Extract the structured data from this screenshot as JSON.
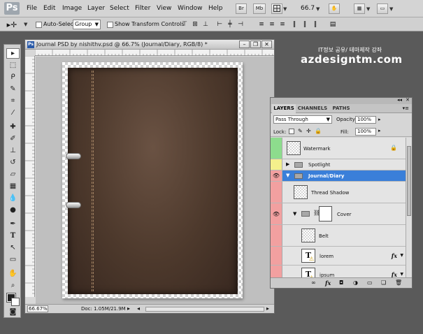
{
  "app": {
    "logo": "Ps"
  },
  "menu": [
    "File",
    "Edit",
    "Image",
    "Layer",
    "Select",
    "Filter",
    "View",
    "Window",
    "Help"
  ],
  "app_bar": {
    "br_label": "Br",
    "mb_label": "Mb",
    "zoom": "66.7"
  },
  "options_bar": {
    "auto_select_label": "Auto-Select:",
    "group_value": "Group",
    "show_transform_label": "Show Transform Controls"
  },
  "document": {
    "title": "Journal PSD by nishithv.psd @ 66.7% (Journal/Diary, RGB/8) *",
    "zoom_field": "66.67%",
    "doc_size": "Doc: 1.05M/21.9M"
  },
  "watermark": {
    "top_text": "IT정보 공유/ 테마제작 강좌",
    "main_text": "azdesigntm.com"
  },
  "layers_panel": {
    "tabs": [
      "LAYERS",
      "CHANNELS",
      "PATHS"
    ],
    "blend_mode": "Pass Through",
    "opacity_label": "Opacity:",
    "opacity_value": "100%",
    "lock_label": "Lock:",
    "fill_label": "Fill:",
    "fill_value": "100%",
    "layers": [
      {
        "name": "Watermark",
        "color": "#8ddc8d",
        "visible": false,
        "kind": "layer",
        "locked": true
      },
      {
        "name": "Spotlight",
        "color": "#f4f08c",
        "visible": false,
        "kind": "group"
      },
      {
        "name": "Journal/Diary",
        "color": "#f2a0a0",
        "visible": true,
        "kind": "group",
        "selected": true
      },
      {
        "name": "Thread Shadow",
        "color": "#f2a0a0",
        "visible": false,
        "kind": "layer"
      },
      {
        "name": "Cover",
        "color": "#f2a0a0",
        "visible": true,
        "kind": "group-mask"
      },
      {
        "name": "Belt",
        "color": "#f2a0a0",
        "visible": false,
        "kind": "layer"
      },
      {
        "name": "lorem",
        "color": "#f2a0a0",
        "visible": false,
        "kind": "text",
        "fx": "fx"
      },
      {
        "name": "ipsum",
        "color": "#f2a0a0",
        "visible": false,
        "kind": "text",
        "fx": "fx"
      }
    ]
  },
  "colors": {
    "selected_row": "#3a7fd9",
    "leather": "#4d392c"
  }
}
